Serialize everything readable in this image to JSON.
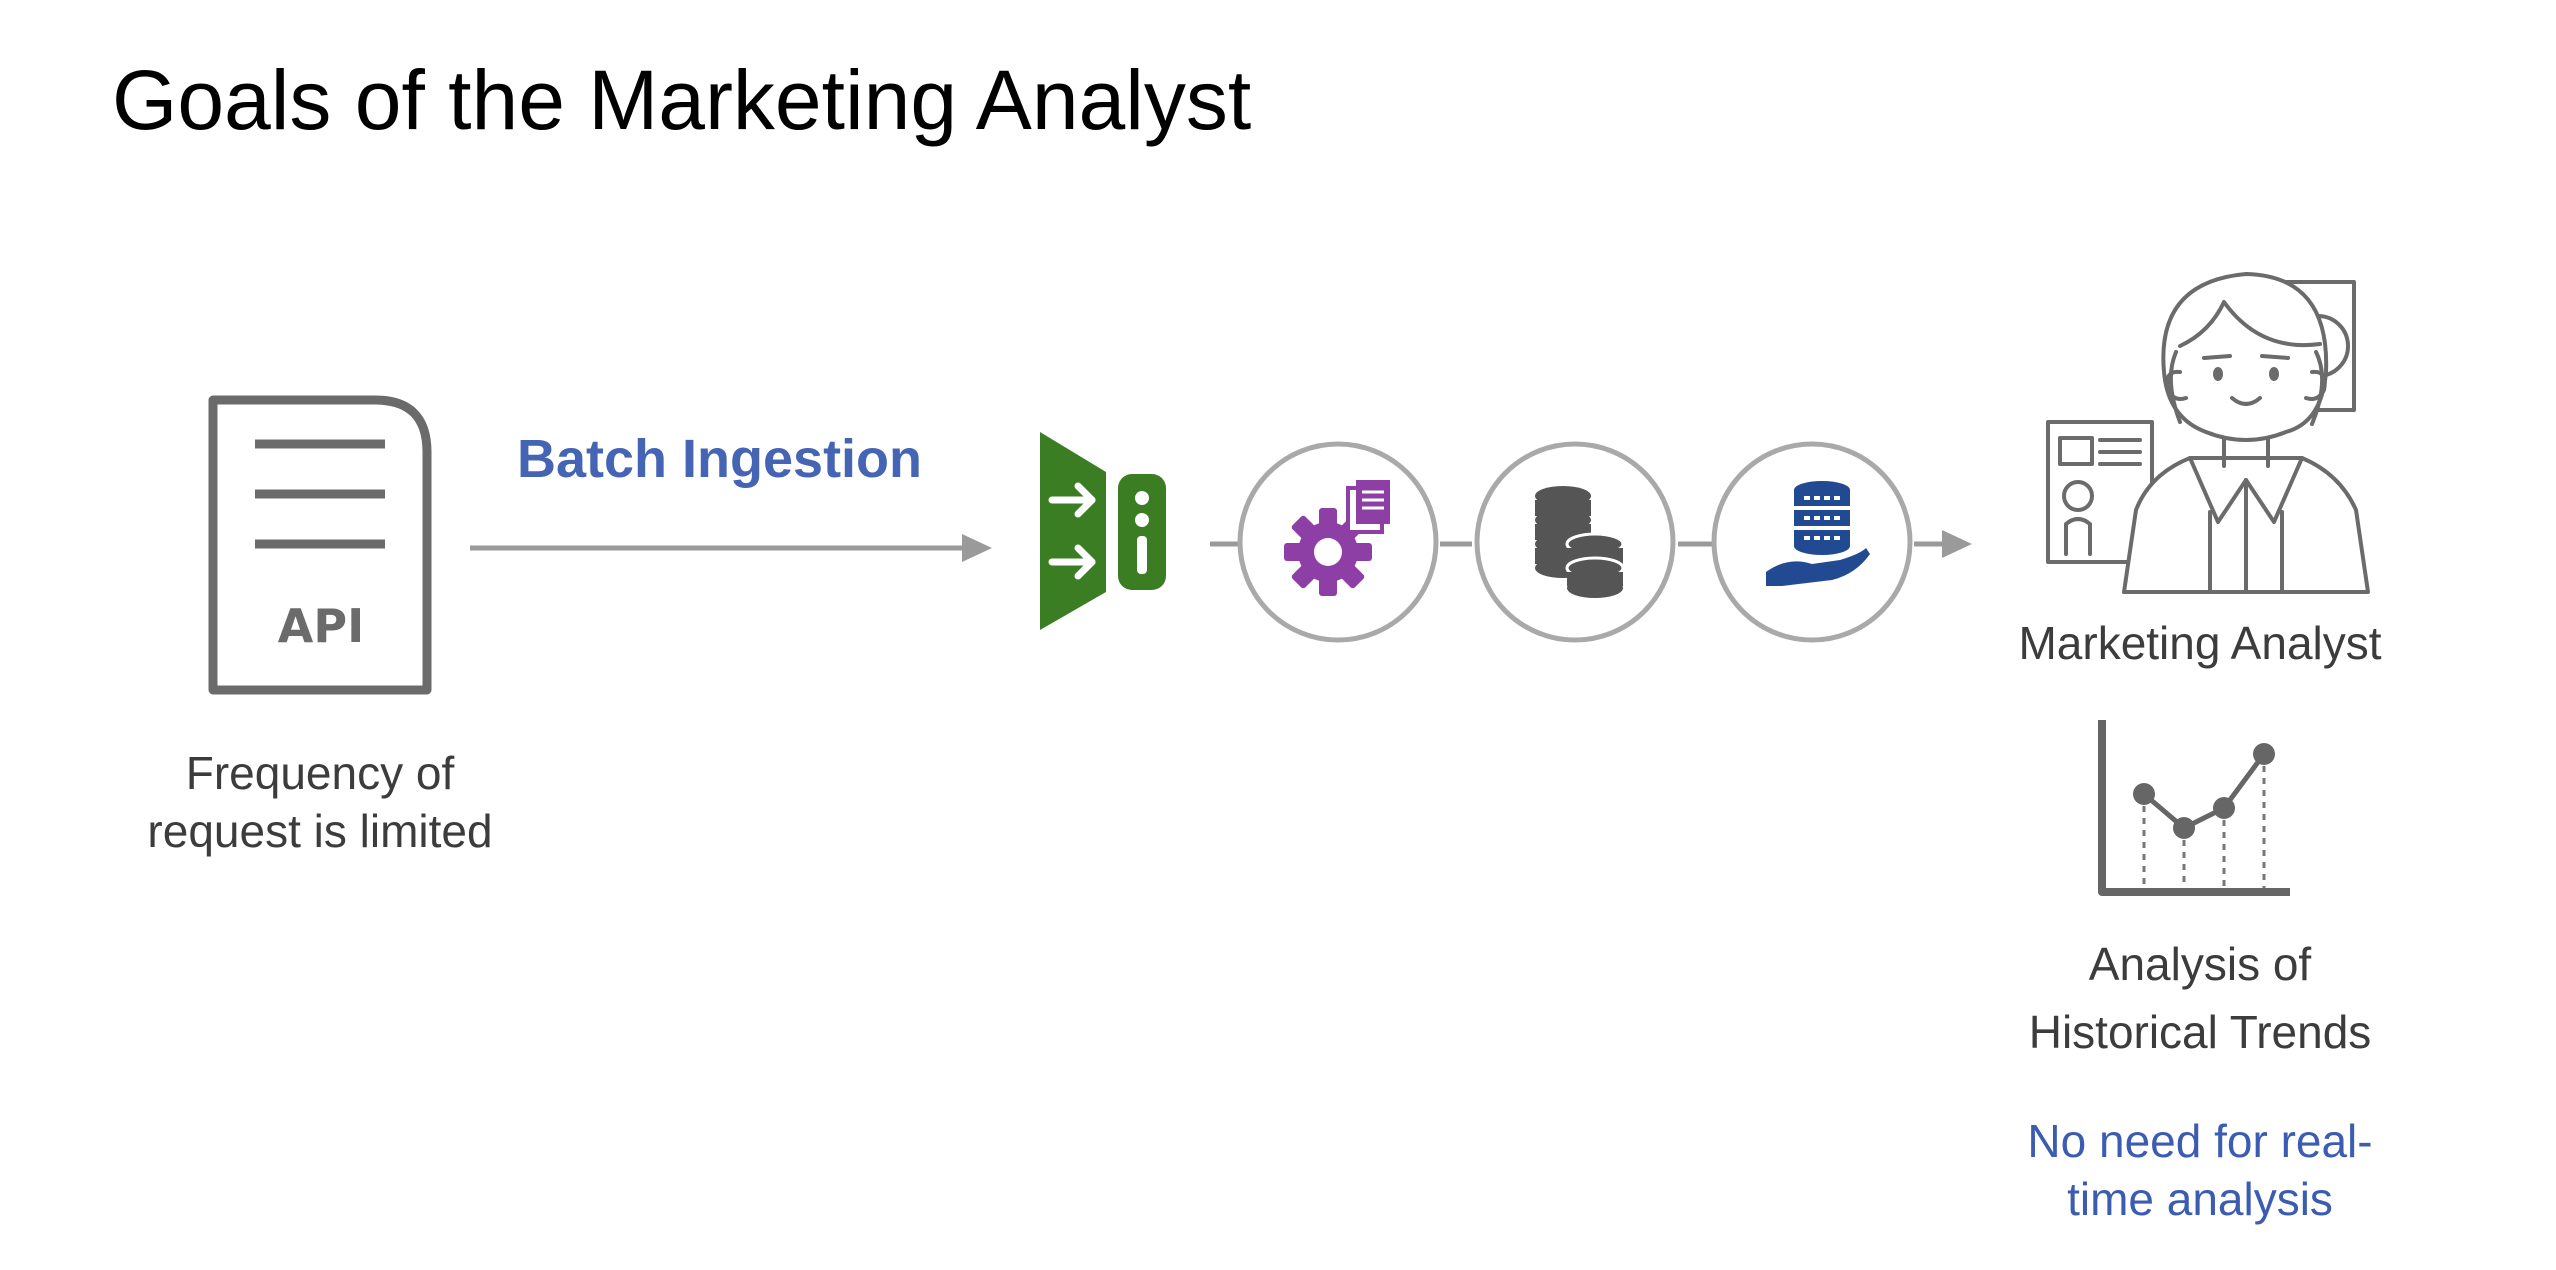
{
  "title": "Goals of the Marketing Analyst",
  "source": {
    "icon_text": "API",
    "caption_line1": "Frequency of",
    "caption_line2": "request is limited"
  },
  "ingestion": {
    "label": "Batch Ingestion"
  },
  "pipeline": {
    "steps": [
      "ingest-gateway-icon",
      "processing-gear-icon",
      "database-icon",
      "data-serving-icon"
    ]
  },
  "analyst": {
    "name": "Marketing Analyst",
    "trend_caption_line1": "Analysis of",
    "trend_caption_line2": "Historical Trends",
    "note_line1": "No need for real-",
    "note_line2": "time analysis"
  },
  "colors": {
    "accent_blue": "#4565b4",
    "green": "#3a7d22",
    "purple": "#8e3fa6",
    "navy": "#224a93",
    "gray": "#6b6b6b"
  }
}
